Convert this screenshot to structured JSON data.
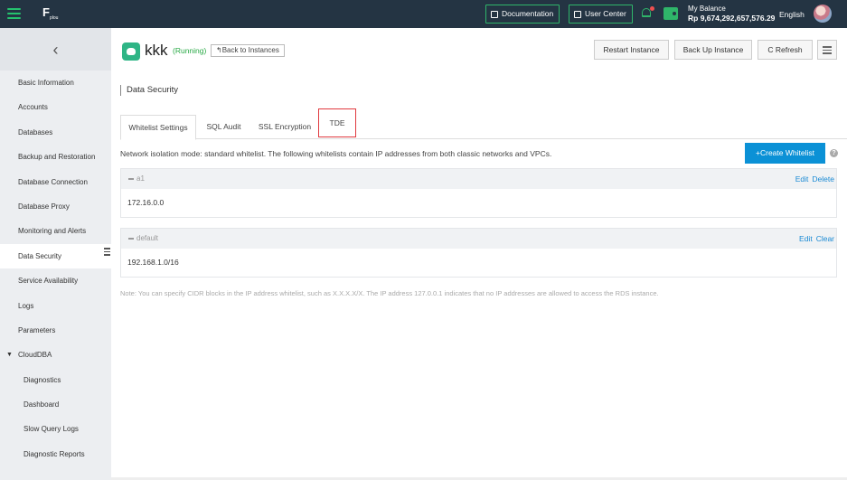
{
  "topbar": {
    "logo_text": "F",
    "logo_sub": "plou",
    "documentation": "Documentation",
    "user_center": "User Center",
    "balance_label": "My Balance",
    "balance_value": "Rp 9,674,292,657,576.29",
    "language": "English"
  },
  "sidebar": {
    "back_glyph": "‹",
    "items": [
      "Basic Information",
      "Accounts",
      "Databases",
      "Backup and Restoration",
      "Database Connection",
      "Database Proxy",
      "Monitoring and Alerts",
      "Data Security",
      "Service Availability",
      "Logs",
      "Parameters",
      "CloudDBA",
      "Diagnostics",
      "Dashboard",
      "Slow Query Logs",
      "Diagnostic Reports"
    ]
  },
  "header": {
    "instance_name": "kkk",
    "status": "(Running)",
    "back_label": "↰Back to Instances",
    "restart": "Restart Instance",
    "backup": "Back Up Instance",
    "refresh": "C Refresh"
  },
  "section_title": "Data Security",
  "tabs": [
    "Whitelist Settings",
    "SQL Audit",
    "SSL Encryption",
    "TDE"
  ],
  "notice": "Network isolation mode: standard whitelist. The following whitelists contain IP addresses from both classic networks and VPCs.",
  "create_whitelist": "+Create Whitelist",
  "help": "?",
  "whitelists": [
    {
      "name": "a1",
      "action1": "Edit",
      "action2": "Delete",
      "ip": "172.16.0.0"
    },
    {
      "name": "default",
      "action1": "Edit",
      "action2": "Clear",
      "ip": "192.168.1.0/16"
    }
  ],
  "note": "Note: You can specify CIDR blocks in the IP address whitelist, such as X.X.X.X/X. The IP address 127.0.0.1 indicates that no IP addresses are allowed to access the RDS instance.",
  "colors": {
    "topbar": "#243443",
    "accent_green": "#2fb56a",
    "primary_blue": "#0b91d6",
    "highlight_red": "#e0393e"
  }
}
